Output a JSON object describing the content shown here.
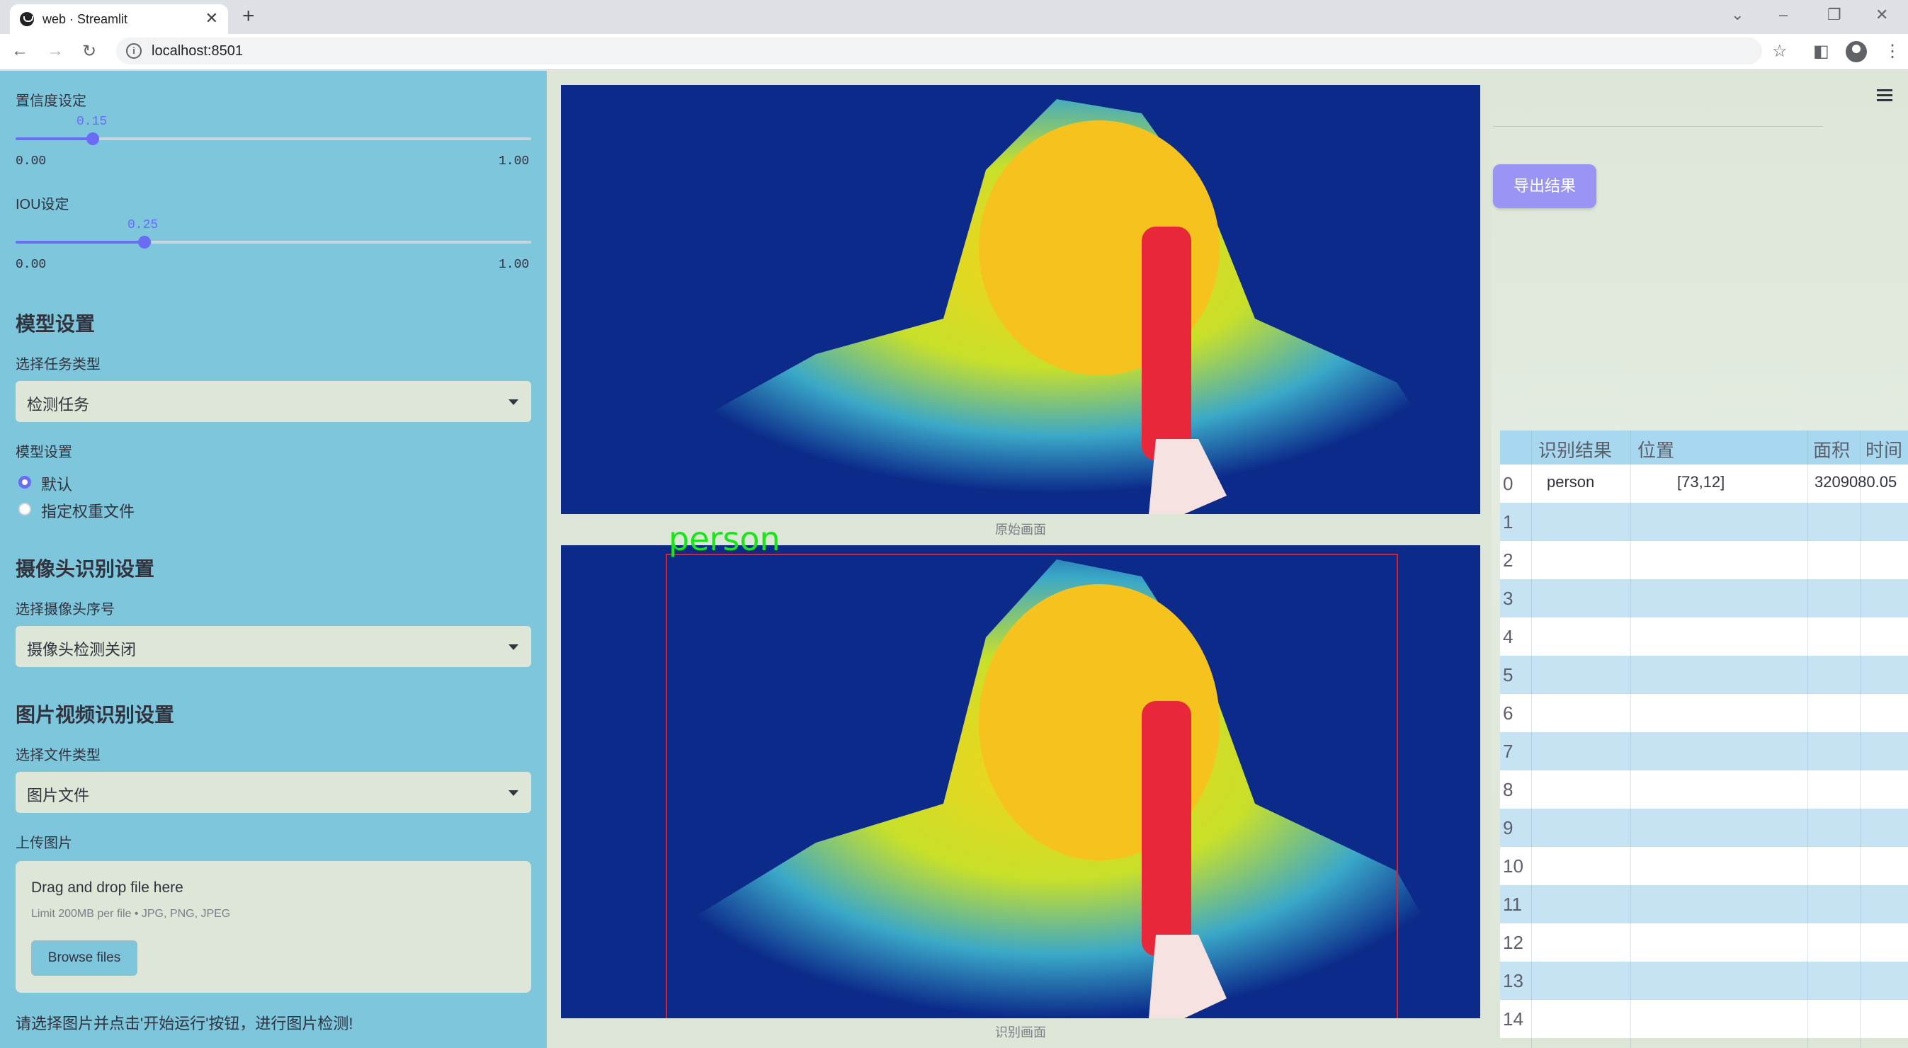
{
  "browser": {
    "tab_title": "web · Streamlit",
    "url": "localhost:8501"
  },
  "sidebar": {
    "confidence": {
      "label": "置信度设定",
      "value": "0.15",
      "min": "0.00",
      "max": "1.00",
      "fraction": 0.15
    },
    "iou": {
      "label": "IOU设定",
      "value": "0.25",
      "min": "0.00",
      "max": "1.00",
      "fraction": 0.25
    },
    "model_section": {
      "heading": "模型设置",
      "task_label": "选择任务类型",
      "task_value": "检测任务",
      "model_label": "模型设置",
      "options": [
        "默认",
        "指定权重文件"
      ],
      "selected": 0
    },
    "camera_section": {
      "heading": "摄像头识别设置",
      "label": "选择摄像头序号",
      "value": "摄像头检测关闭"
    },
    "media_section": {
      "heading": "图片视频识别设置",
      "file_type_label": "选择文件类型",
      "file_type_value": "图片文件",
      "upload_label": "上传图片",
      "drop_text": "Drag and drop file here",
      "limit_text": "Limit 200MB per file • JPG, PNG, JPEG",
      "browse_label": "Browse files"
    },
    "hint": "请选择图片并点击'开始运行'按钮，进行图片检测!"
  },
  "main": {
    "original_caption": "原始画面",
    "result_caption": "识别画面",
    "detection_label": "person"
  },
  "right": {
    "export_label": "导出结果",
    "table": {
      "headers": [
        "识别结果",
        "位置",
        "面积",
        "时间"
      ],
      "rows": [
        {
          "idx": "0",
          "result": "person",
          "pos": "[73,12]",
          "area": "3209080.05"
        },
        {
          "idx": "1"
        },
        {
          "idx": "2"
        },
        {
          "idx": "3"
        },
        {
          "idx": "4"
        },
        {
          "idx": "5"
        },
        {
          "idx": "6"
        },
        {
          "idx": "7"
        },
        {
          "idx": "8"
        },
        {
          "idx": "9"
        },
        {
          "idx": "10"
        },
        {
          "idx": "11"
        },
        {
          "idx": "12"
        },
        {
          "idx": "13"
        },
        {
          "idx": "14"
        }
      ]
    }
  },
  "colors": {
    "accent": "#6a6cf6",
    "sidebar_bg": "#7ec6dc",
    "main_bg": "#dde6d7",
    "export_bg": "#9a95f5",
    "box": "#e0202a",
    "label": "#19e619"
  },
  "icons": [
    "streamlit-favicon",
    "close-icon",
    "plus-icon",
    "back-icon",
    "forward-icon",
    "reload-icon",
    "info-icon",
    "star-icon",
    "sidepanel-icon",
    "profile-icon",
    "kebab-icon",
    "hamburger-icon",
    "chevron-down-icon",
    "radio-icon"
  ]
}
